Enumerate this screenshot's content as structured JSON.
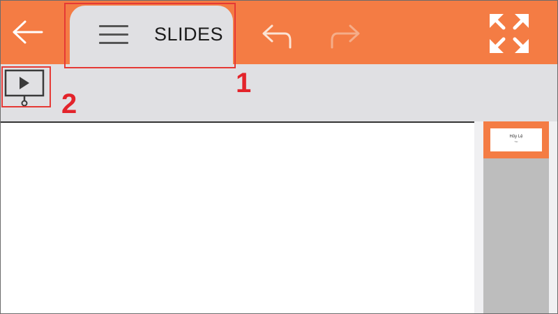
{
  "colors": {
    "accent": "#f47c44",
    "toolbar": "#e0e0e3",
    "thumb_panel": "#bdbdbd",
    "annotation": "#e53935"
  },
  "appbar": {
    "back_icon": "arrow-left-icon",
    "tab_label": "SLIDES",
    "menu_icon": "hamburger-menu-icon",
    "undo_icon": "undo-icon",
    "redo_icon": "redo-icon",
    "fullscreen_icon": "fullscreen-expand-icon"
  },
  "toolbar": {
    "play_icon": "slideshow-play-icon"
  },
  "annotations": [
    {
      "label": "1"
    },
    {
      "label": "2"
    }
  ],
  "slides": [
    {
      "title": "Hủy Lệ",
      "subtitle": "Tác"
    }
  ]
}
